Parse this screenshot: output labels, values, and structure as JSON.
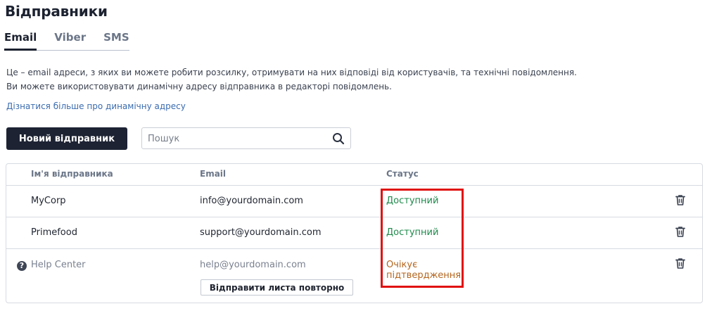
{
  "page": {
    "title": "Відправники"
  },
  "tabs": [
    {
      "label": "Email",
      "active": true
    },
    {
      "label": "Viber",
      "active": false
    },
    {
      "label": "SMS",
      "active": false
    }
  ],
  "description": {
    "line1": "Це – email адреси, з яких ви можете робити розсилку, отримувати на них відповіді від користувачів, та технічні повідомлення.",
    "line2": "Ви можете використовувати динамічну адресу відправника в редакторі повідомлень.",
    "link": "Дізнатися більше про динамічну адресу"
  },
  "toolbar": {
    "new_sender_label": "Новий відправник",
    "search_placeholder": "Пошук"
  },
  "table": {
    "headers": {
      "name": "Ім'я відправника",
      "email": "Email",
      "status": "Статус"
    },
    "rows": [
      {
        "name": "MyCorp",
        "email": "info@yourdomain.com",
        "status": "Доступний",
        "state": "available"
      },
      {
        "name": "Primefood",
        "email": "support@yourdomain.com",
        "status": "Доступний",
        "state": "available"
      },
      {
        "name": "Help Center",
        "email": "help@yourdomain.com",
        "status_line1": "Очікує",
        "status_line2": "підтвердження",
        "state": "pending",
        "resend_label": "Відправити листа повторно",
        "help_icon": "?"
      }
    ]
  },
  "colors": {
    "primary_button": "#1d2333",
    "link": "#3b6cb0",
    "status_available": "#1e8a4b",
    "status_pending": "#b5651d",
    "highlight": "#e01010"
  },
  "icons": {
    "search": "search-icon",
    "trash": "trash-icon",
    "help": "help-icon"
  }
}
